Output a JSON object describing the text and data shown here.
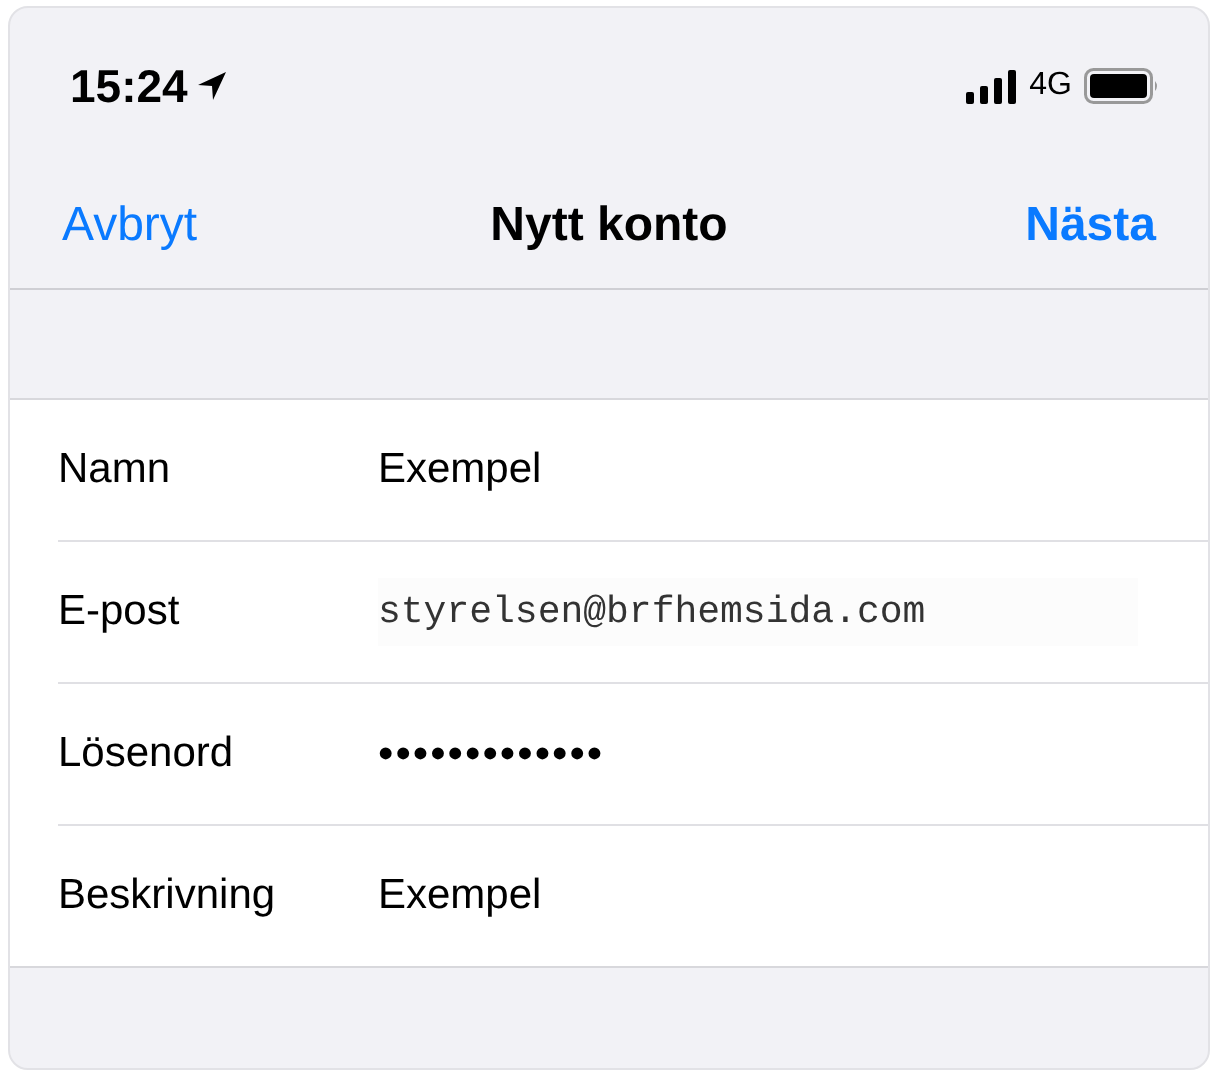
{
  "status_bar": {
    "time": "15:24",
    "network": "4G"
  },
  "nav": {
    "cancel": "Avbryt",
    "title": "Nytt konto",
    "next": "Nästa"
  },
  "fields": [
    {
      "kind": "text",
      "label": "Namn",
      "value": "Exempel"
    },
    {
      "kind": "code",
      "label": "E-post",
      "value": "styrelsen@brfhemsida.com"
    },
    {
      "kind": "password",
      "label": "Lösenord",
      "value": "•••••••••••••"
    },
    {
      "kind": "text",
      "label": "Beskrivning",
      "value": "Exempel"
    }
  ]
}
